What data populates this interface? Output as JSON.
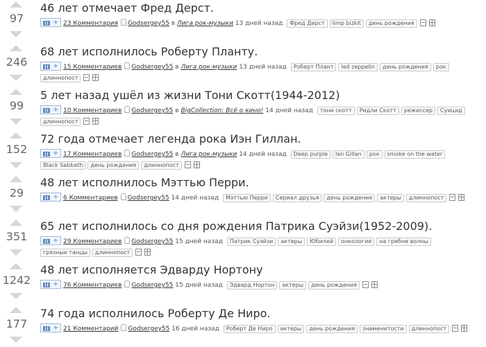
{
  "stories": [
    {
      "rating": "97",
      "title": "46 лет отмечает Фред Дерст.",
      "comments": "23 Комментария",
      "in": "в",
      "author": "Godsergey55",
      "community": "Лига рок-музыки",
      "time": "13 дней назад",
      "tags": [
        "Фред Дерст",
        "limp bizkit",
        "день рождения"
      ],
      "wrap_tags": []
    },
    {
      "rating": "246",
      "title": "68 лет исполнилось Роберту Планту.",
      "comments": "15 Комментариев",
      "in": "в",
      "author": "Godsergey55",
      "community": "Лига рок-музыки",
      "time": "13 дней назад",
      "tags": [
        "Роберт Плант",
        "led zeppelin",
        "день рождения",
        "рок"
      ],
      "wrap_tags": [
        "длиннопост"
      ]
    },
    {
      "rating": "99",
      "title": "5 лет назад ушёл из жизни Тони Скотт(1944-2012)",
      "comments": "10 Комментариев",
      "in": "в",
      "author": "Godsergey55",
      "community": "BigCollection: Всё о кино!",
      "time": "14 дней назад",
      "tags": [
        "тони скотт",
        "Ридли Скотт",
        "режиссер",
        "Суицид"
      ],
      "wrap_tags": [
        "длиннопост"
      ]
    },
    {
      "rating": "152",
      "title": "72 года отмечает легенда рока Иэн Гиллан.",
      "comments": "17 Комментариев",
      "in": "в",
      "author": "Godsergey55",
      "community": "Лига рок-музыки",
      "time": "14 дней назад",
      "tags": [
        "Deep purple",
        "Ian Gillan",
        "рок",
        "smoke on the water"
      ],
      "wrap_tags": [
        "Black Sabbath",
        "день рождения",
        "длиннопост"
      ]
    },
    {
      "rating": "29",
      "title": "48 лет исполнилось Мэттью Перри.",
      "comments": "6 Комментариев",
      "in": "",
      "author": "Godsergey55",
      "community": "",
      "time": "14 дней назад",
      "tags": [
        "Мэттью Перри",
        "Сериал друзья",
        "день рождения",
        "актеры",
        "длиннопост"
      ],
      "wrap_tags": []
    },
    {
      "rating": "351",
      "title": "65 лет исполнилось со дня рождения Патрика Суэйзи(1952-2009).",
      "comments": "29 Комментариев",
      "in": "",
      "author": "Godsergey55",
      "community": "",
      "time": "15 дней назад",
      "tags": [
        "Патрик Суэйзи",
        "актеры",
        "Юбилей",
        "онкология",
        "на гребне волны"
      ],
      "wrap_tags": [
        "грязные танцы",
        "длиннопост"
      ]
    },
    {
      "rating": "1242",
      "title": "48 лет исполняется Эдварду Нортону",
      "comments": "76 Комментариев",
      "in": "",
      "author": "Godsergey55",
      "community": "",
      "time": "15 дней назад",
      "tags": [
        "Эдвард Нортон",
        "актеры",
        "день рождения"
      ],
      "wrap_tags": []
    },
    {
      "rating": "177",
      "title": "74 года исполнилось Роберту Де Ниро.",
      "comments": "21 Комментарий",
      "in": "",
      "author": "Godsergey55",
      "community": "",
      "time": "16 дней назад",
      "tags": [
        "Роберт Де Ниро",
        "актеры",
        "день рождения",
        "знаменитости",
        "длиннопост"
      ],
      "wrap_tags": []
    }
  ],
  "icons": {
    "add": "add-to-list-icon",
    "user": "user-icon",
    "save": "save-icon",
    "hide": "hide-icon"
  },
  "colors": {
    "text": "#333333",
    "arrow": "#d6d6d6",
    "button_border": "#9fb8d6"
  }
}
